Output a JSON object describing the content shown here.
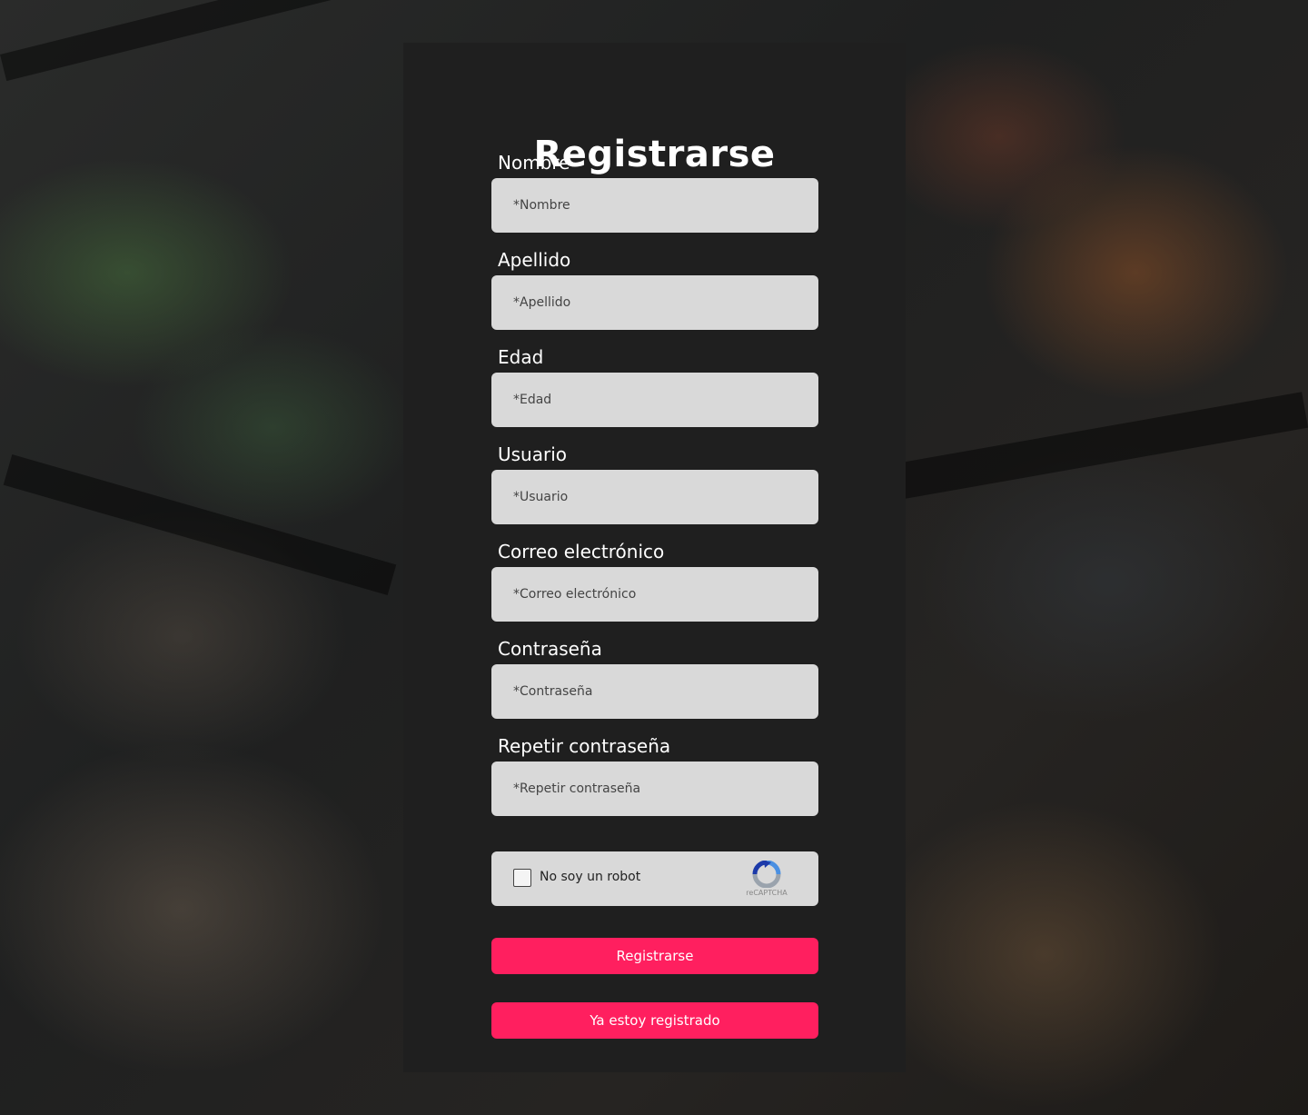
{
  "form": {
    "title": "Registrarse",
    "fields": [
      {
        "label": "Nombre",
        "placeholder": "*Nombre"
      },
      {
        "label": "Apellido",
        "placeholder": "*Apellido"
      },
      {
        "label": "Edad",
        "placeholder": "*Edad"
      },
      {
        "label": "Usuario",
        "placeholder": "*Usuario"
      },
      {
        "label": "Correo electrónico",
        "placeholder": "*Correo electrónico"
      },
      {
        "label": "Contraseña",
        "placeholder": "*Contraseña"
      },
      {
        "label": "Repetir contraseña",
        "placeholder": "*Repetir contraseña"
      }
    ],
    "captcha": {
      "label": "No soy un robot",
      "brand": "reCAPTCHA",
      "checked": false
    },
    "submit_label": "Registrarse",
    "login_label": "Ya estoy registrado"
  },
  "colors": {
    "panel": "#1f1f1f",
    "input_bg": "#d9d9d9",
    "accent": "#ff1f5f"
  },
  "icons": {
    "captcha": "recaptcha-icon"
  }
}
